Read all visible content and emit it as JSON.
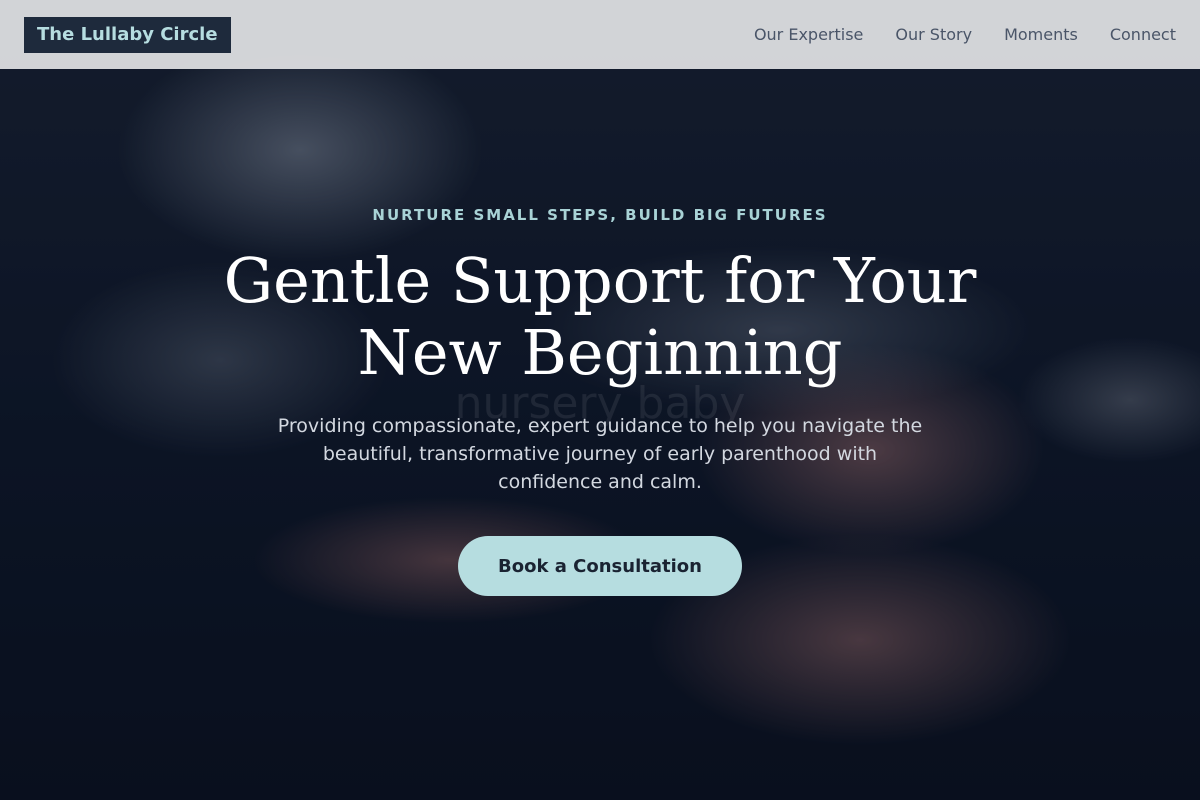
{
  "header": {
    "logo": "The Lullaby Circle",
    "nav": [
      {
        "label": "Our Expertise"
      },
      {
        "label": "Our Story"
      },
      {
        "label": "Moments"
      },
      {
        "label": "Connect"
      }
    ]
  },
  "hero": {
    "eyebrow": "NURTURE SMALL STEPS, BUILD BIG FUTURES",
    "headline": "Gentle Support for Your New Beginning",
    "watermark": "nursery baby",
    "subtext": "Providing compassionate, expert guidance to help you navigate the beautiful, transformative journey of early parenthood with confidence and calm.",
    "cta_label": "Book a Consultation"
  },
  "colors": {
    "accent": "#b6dde0",
    "logo_bg": "#1e2a3c",
    "nav_text": "#4a5568",
    "header_bg": "#e1e2e4"
  }
}
